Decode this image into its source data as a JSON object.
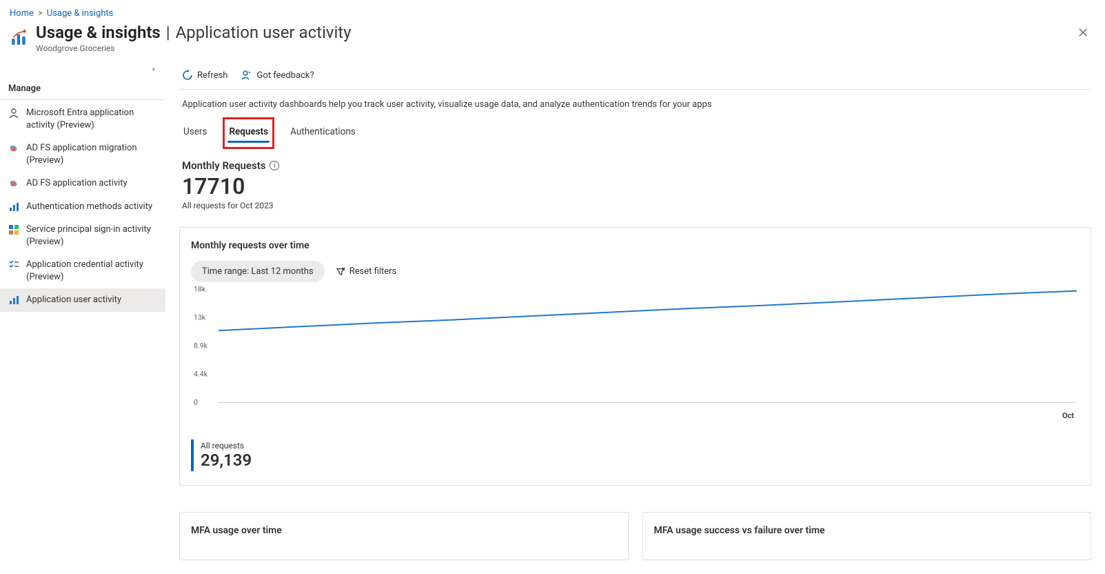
{
  "breadcrumb": {
    "home": "Home",
    "current": "Usage & insights"
  },
  "header": {
    "title_main": "Usage & insights",
    "title_sep": "|",
    "title_sub": "Application user activity",
    "subtitle": "Woodgrove Groceries"
  },
  "sidebar": {
    "section": "Manage",
    "items": [
      {
        "label": "Microsoft Entra application activity (Preview)",
        "icon": "person"
      },
      {
        "label": "AD FS application migration (Preview)",
        "icon": "migrate"
      },
      {
        "label": "AD FS application activity",
        "icon": "migrate"
      },
      {
        "label": "Authentication methods activity",
        "icon": "bars"
      },
      {
        "label": "Service principal sign-in activity (Preview)",
        "icon": "grid"
      },
      {
        "label": "Application credential activity (Preview)",
        "icon": "checklist"
      },
      {
        "label": "Application user activity",
        "icon": "bars",
        "selected": true
      }
    ]
  },
  "toolbar": {
    "refresh": "Refresh",
    "feedback": "Got feedback?"
  },
  "description": "Application user activity dashboards help you track user activity, visualize usage data, and analyze authentication trends for your apps",
  "tabs": [
    {
      "id": "users",
      "label": "Users"
    },
    {
      "id": "requests",
      "label": "Requests",
      "active": true,
      "highlighted": true
    },
    {
      "id": "auth",
      "label": "Authentications"
    }
  ],
  "kpi": {
    "title": "Monthly Requests",
    "value": "17710",
    "subtitle": "All requests for Oct 2023"
  },
  "chart_card": {
    "title": "Monthly requests over time",
    "time_pill": "Time range: Last 12 months",
    "reset": "Reset filters",
    "legend_label": "All requests",
    "legend_value": "29,139",
    "x_end_label": "Oct"
  },
  "chart_data": {
    "type": "line",
    "title": "Monthly requests over time",
    "xlabel": "",
    "ylabel": "",
    "ylim": [
      0,
      18000
    ],
    "y_ticks": [
      "18k",
      "13k",
      "8.9k",
      "4.4k",
      "0"
    ],
    "x_end": "Oct",
    "series": [
      {
        "name": "All requests",
        "color": "#1f77d0",
        "values": [
          11400,
          12000,
          12600,
          13100,
          13700,
          14300,
          14900,
          15400,
          16000,
          16600,
          17200,
          17710
        ]
      }
    ]
  },
  "bottom_cards": {
    "left_title": "MFA usage over time",
    "right_title": "MFA usage success vs failure over time"
  }
}
